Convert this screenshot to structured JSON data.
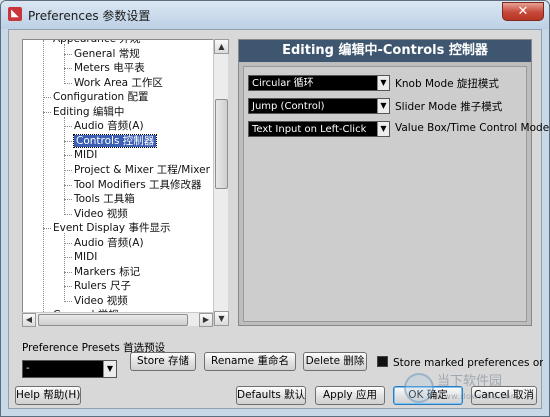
{
  "window": {
    "title": "Preferences 参数设置",
    "app_icon": "cubase-logo-icon",
    "close_label": "✕"
  },
  "tree": {
    "items": [
      {
        "label": "Appearance 外观",
        "level": 0
      },
      {
        "label": "General 常规",
        "level": 1
      },
      {
        "label": "Meters 电平表",
        "level": 1
      },
      {
        "label": "Work Area 工作区",
        "level": 1
      },
      {
        "label": "Configuration 配置",
        "level": 0
      },
      {
        "label": "Editing 编辑中",
        "level": 0
      },
      {
        "label": "Audio 音频(A)",
        "level": 1
      },
      {
        "label": "Controls 控制器",
        "level": 1,
        "selected": true
      },
      {
        "label": "MIDI",
        "level": 1
      },
      {
        "label": "Project & Mixer 工程/Mixer",
        "level": 1
      },
      {
        "label": "Tool Modifiers 工具修改器",
        "level": 1
      },
      {
        "label": "Tools 工具箱",
        "level": 1
      },
      {
        "label": "Video 视频",
        "level": 1
      },
      {
        "label": "Event Display 事件显示",
        "level": 0
      },
      {
        "label": "Audio 音频(A)",
        "level": 1
      },
      {
        "label": "MIDI",
        "level": 1
      },
      {
        "label": "Markers 标记",
        "level": 1
      },
      {
        "label": "Rulers 尺子",
        "level": 1
      },
      {
        "label": "Video 视频",
        "level": 1
      },
      {
        "label": "General 常规",
        "level": 0
      }
    ]
  },
  "panel": {
    "title": "Editing 编辑中-Controls 控制器",
    "options": [
      {
        "value": "Circular 循环",
        "label": "Knob Mode 旋扭模式"
      },
      {
        "value": "Jump (Control)",
        "label": "Slider Mode 推子模式"
      },
      {
        "value": "Text Input on Left-Click",
        "label": "Value Box/Time Control Mode"
      }
    ]
  },
  "presets": {
    "label": "Preference Presets 首选预设",
    "selected": "-",
    "store_label": "Store 存储",
    "rename_label": "Rename 重命名",
    "delete_label": "Delete 删除",
    "store_marked_label": "Store marked preferences only 仅存"
  },
  "footer": {
    "help_label": "Help 帮助(H)",
    "defaults_label": "Defaults 默认",
    "apply_label": "Apply 应用",
    "ok_label": "OK 确定",
    "cancel_label": "Cancel 取消"
  },
  "watermark": {
    "text": "当下软件园",
    "sub": "www.downxia.com"
  }
}
